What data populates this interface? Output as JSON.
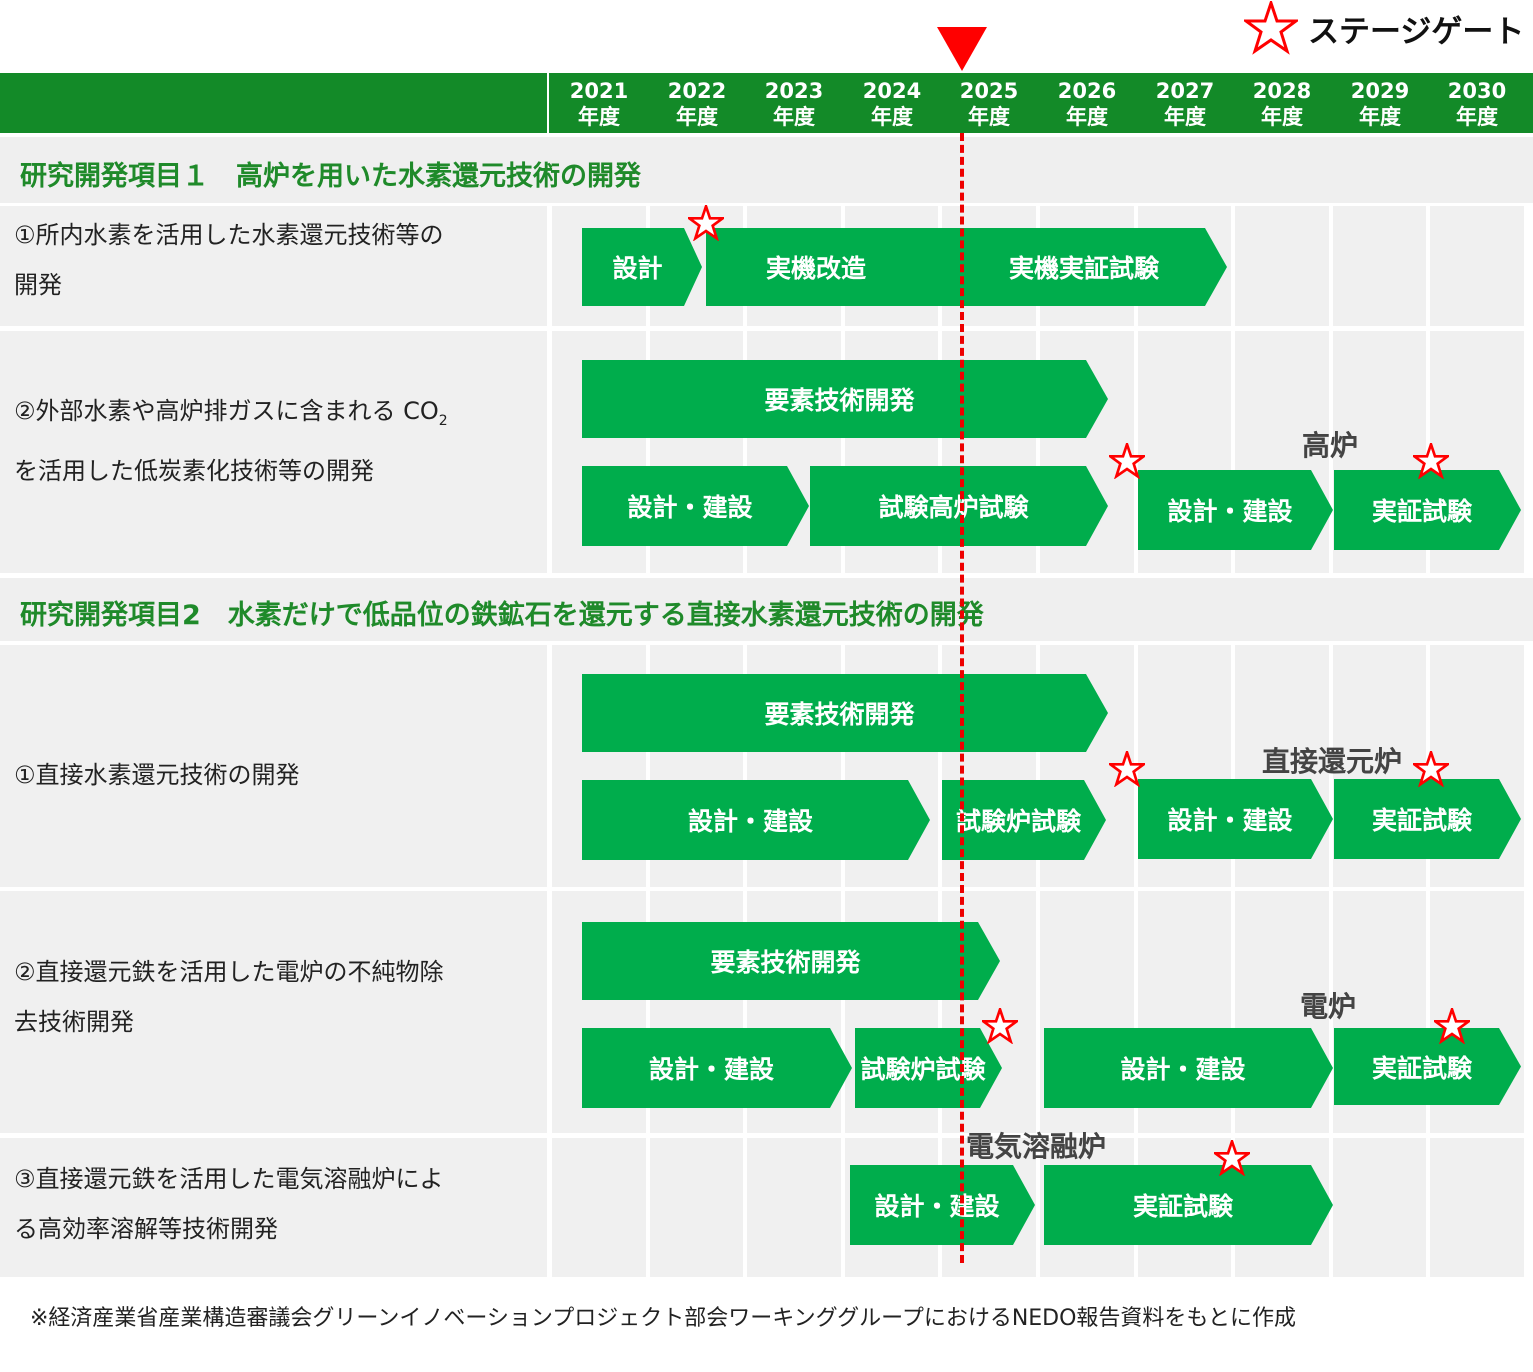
{
  "legend": {
    "label": "ステージゲート",
    "icon": "star-outline-icon",
    "color": "#ff0000"
  },
  "header": {
    "years": [
      {
        "y": "2021",
        "u": "年度"
      },
      {
        "y": "2022",
        "u": "年度"
      },
      {
        "y": "2023",
        "u": "年度"
      },
      {
        "y": "2024",
        "u": "年度"
      },
      {
        "y": "2025",
        "u": "年度"
      },
      {
        "y": "2026",
        "u": "年度"
      },
      {
        "y": "2027",
        "u": "年度"
      },
      {
        "y": "2028",
        "u": "年度"
      },
      {
        "y": "2029",
        "u": "年度"
      },
      {
        "y": "2030",
        "u": "年度"
      }
    ]
  },
  "current_marker": {
    "year": "2025",
    "color": "#ff0000"
  },
  "sections": [
    {
      "title": "研究開発項目１　高炉を用いた水素還元技術の開発"
    },
    {
      "title": "研究開発項目2　水素だけで低品位の鉄鉱石を還元する直接水素還元技術の開発"
    }
  ],
  "rows": [
    {
      "label1": "①所内水素を活用した水素還元技術等の",
      "label2": "開発"
    },
    {
      "label1": "②外部水素や高炉排ガスに含まれる CO",
      "label1_sub": "2",
      "label2": "を活用した低炭素化技術等の開発",
      "group": "高炉"
    },
    {
      "label1": "①直接水素還元技術の開発",
      "label2": "",
      "group": "直接還元炉"
    },
    {
      "label1": "②直接還元鉄を活用した電炉の不純物除",
      "label2": "去技術開発",
      "group": "電炉"
    },
    {
      "label1": "③直接還元鉄を活用した電気溶融炉によ",
      "label2": "る高効率溶解等技術開発",
      "group": "電気溶融炉"
    }
  ],
  "bars": [
    "設計",
    "実機改造",
    "実機実証試験",
    "要素技術開発",
    "設計・建設",
    "試験高炉試験",
    "設計・建設",
    "実証試験",
    "要素技術開発",
    "設計・建設",
    "試験炉試験",
    "設計・建設",
    "実証試験",
    "要素技術開発",
    "設計・建設",
    "試験炉試験",
    "設計・建設",
    "実証試験",
    "設計・建設",
    "実証試験"
  ],
  "colors": {
    "header": "#138a28",
    "bar": "#00ad4c",
    "section_title": "#1f8a2a",
    "background": "#efefef"
  },
  "footnote": "※経済産業省産業構造審議会グリーンイノベーションプロジェクト部会ワーキンググループにおけるNEDO報告資料をもとに作成"
}
